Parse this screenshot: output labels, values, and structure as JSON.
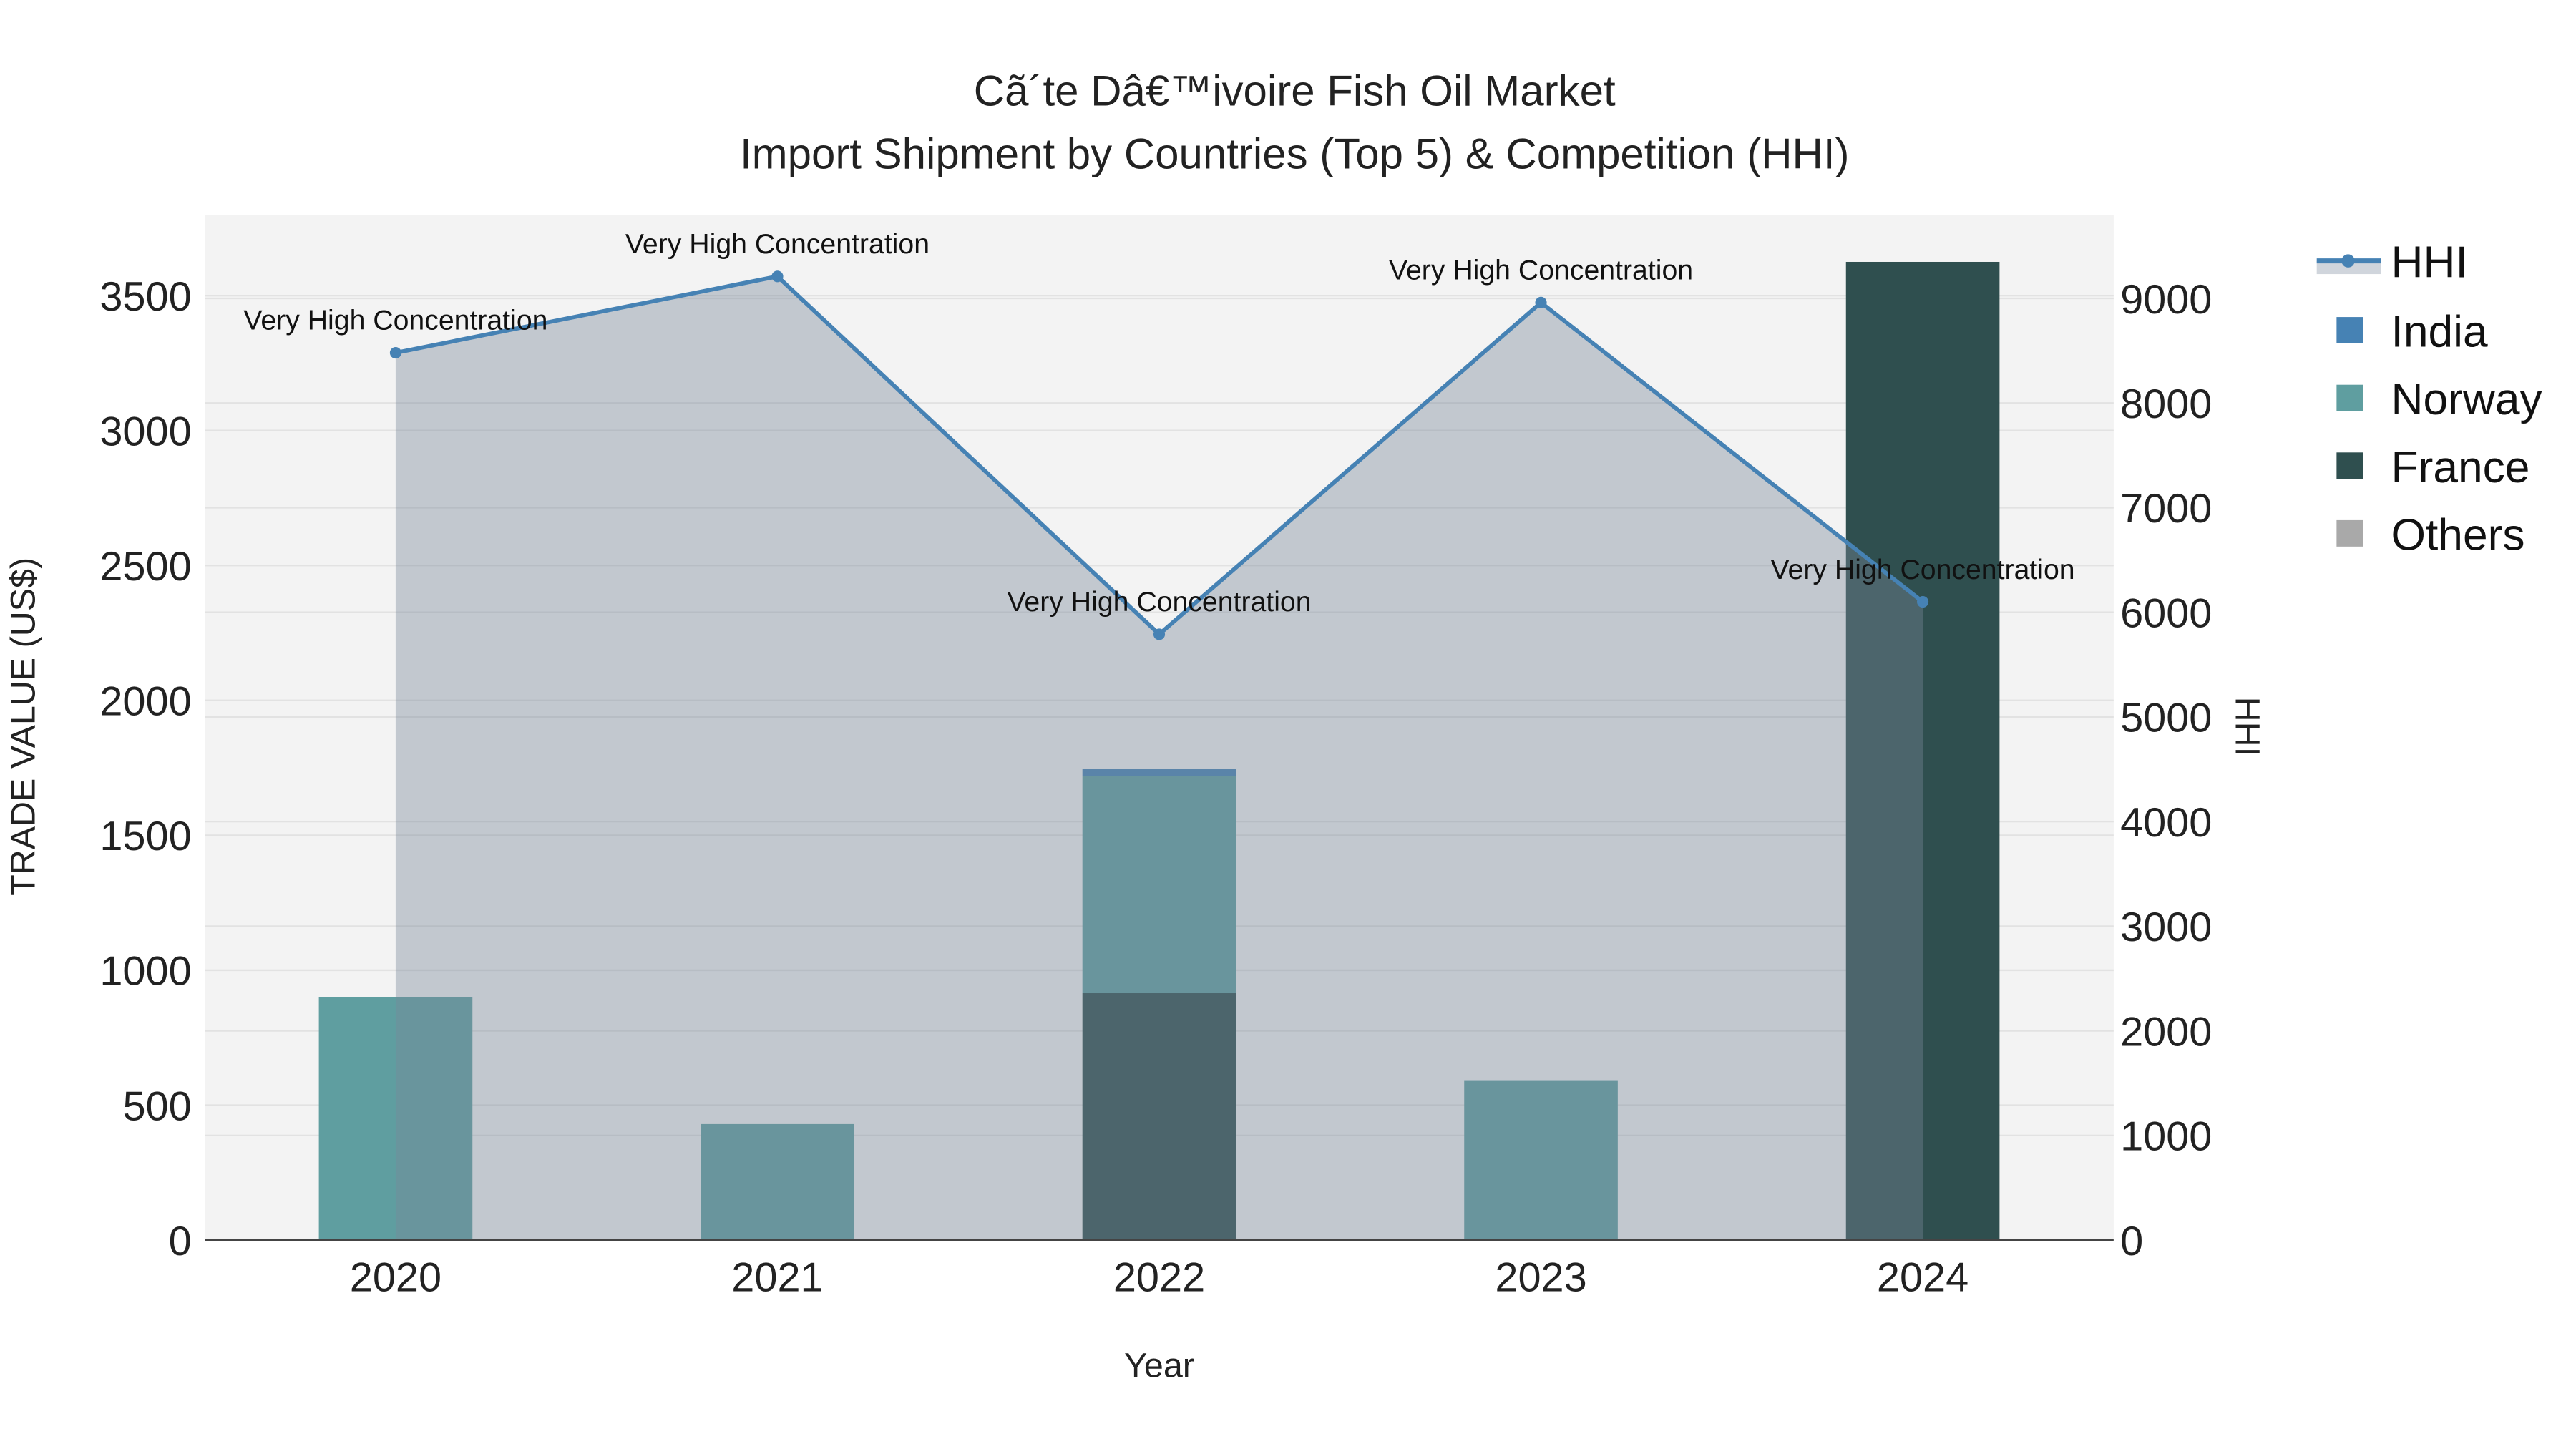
{
  "chart_data": {
    "type": "bar",
    "title_line1": "Cã´te Dâ€™ivoire Fish Oil Market",
    "title_line2": "Import Shipment by Countries (Top 5) & Competition (HHI)",
    "xlabel": "Year",
    "ylabel": "TRADE VALUE (US$)",
    "y2label": "HHI",
    "categories": [
      "2020",
      "2021",
      "2022",
      "2023",
      "2024"
    ],
    "ylim": [
      0,
      3800
    ],
    "y2lim": [
      0,
      9800
    ],
    "yticks": [
      0,
      500,
      1000,
      1500,
      2000,
      2500,
      3000,
      3500
    ],
    "y2ticks": [
      0,
      1000,
      2000,
      3000,
      4000,
      5000,
      6000,
      7000,
      8000,
      9000
    ],
    "barmode": "stack",
    "series": [
      {
        "name": "France",
        "color": "#2f4f4f",
        "values": [
          0,
          0,
          915,
          0,
          3625
        ]
      },
      {
        "name": "Norway",
        "color": "#5f9ea0",
        "values": [
          900,
          430,
          805,
          590,
          0
        ]
      },
      {
        "name": "India",
        "color": "#4682b4",
        "values": [
          0,
          0,
          25,
          0,
          0
        ]
      },
      {
        "name": "Others",
        "color": "#a9a9a9",
        "values": [
          0,
          0,
          0,
          0,
          0
        ]
      }
    ],
    "hhi": {
      "name": "HHI",
      "color": "#4682b4",
      "fill": "#778899",
      "values": [
        8480,
        9210,
        5790,
        8960,
        6100
      ],
      "labels": [
        "Very High Concentration",
        "Very High Concentration",
        "Very High Concentration",
        "Very High Concentration",
        "Very High Concentration"
      ]
    },
    "legend": {
      "position": "right",
      "items": [
        "HHI",
        "India",
        "Norway",
        "France",
        "Others"
      ]
    }
  }
}
